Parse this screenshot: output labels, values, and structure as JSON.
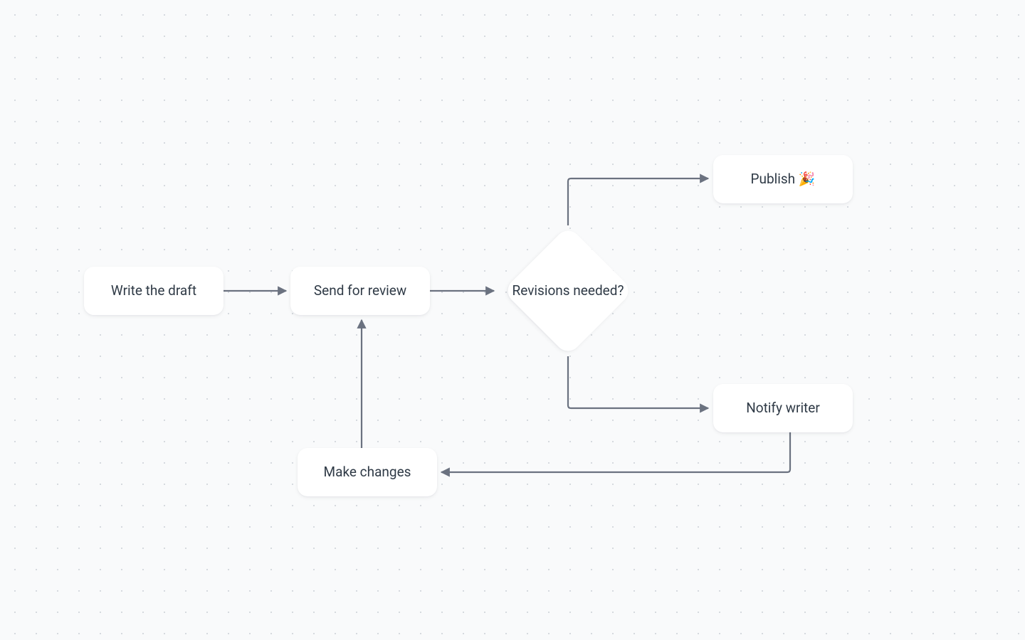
{
  "nodes": {
    "write_draft": {
      "label": "Write the draft"
    },
    "send_review": {
      "label": "Send for review"
    },
    "revisions": {
      "label": "Revisions needed?"
    },
    "publish": {
      "label": "Publish 🎉"
    },
    "notify_writer": {
      "label": "Notify writer"
    },
    "make_changes": {
      "label": "Make changes"
    }
  },
  "colors": {
    "arrow": "#6b7280"
  }
}
